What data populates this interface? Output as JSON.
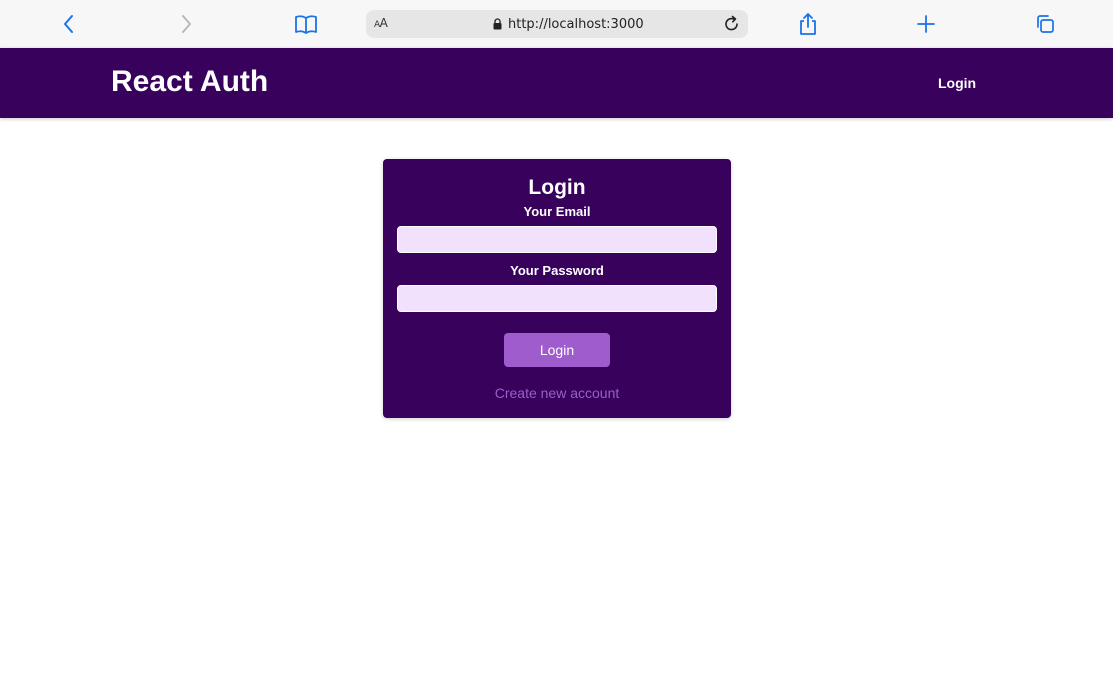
{
  "browser": {
    "url": "http://localhost:3000",
    "reader_label_small": "A",
    "reader_label_large": "A",
    "icons": [
      "back-icon",
      "forward-icon",
      "bookmarks-icon",
      "lock-icon",
      "reload-icon",
      "share-icon",
      "new-tab-icon",
      "tabs-icon"
    ],
    "accent_color": "#1a73e8"
  },
  "header": {
    "logo": "React Auth",
    "nav_login": "Login",
    "background": "#38015c"
  },
  "auth_form": {
    "title": "Login",
    "email_label": "Your Email",
    "email_value": "",
    "password_label": "Your Password",
    "password_value": "",
    "submit_label": "Login",
    "toggle_label": "Create new account",
    "card_color": "#38015c",
    "button_color": "#9f5ccc",
    "input_color": "#f1e1fc"
  }
}
